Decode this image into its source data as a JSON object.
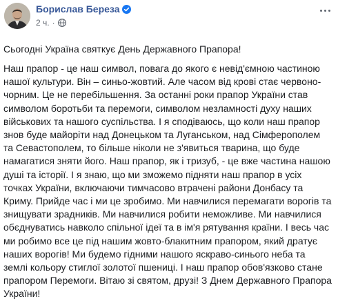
{
  "author": {
    "name": "Борислав Береза"
  },
  "meta": {
    "time": "2 ч."
  },
  "icons": {
    "verified": "verified-badge-icon",
    "privacy": "globe-icon",
    "menu": "more-options-icon",
    "verified_color": "#1877f2",
    "link_color": "#385898"
  },
  "post": {
    "intro": "Сьогодні Україна святкує День Державного Прапора!",
    "lines": [
      "Наш прапор - це наш символ, повага до якого є невід'ємною частиною",
      "нашої культури. Він – синьо-жовтий. Але часом від крові стає червоно-",
      "чорним. Це не перебільшення. За останні роки прапор України став",
      "символом боротьби та перемоги, символом незламності духу наших",
      "військових та нашого суспільства. І я сподіваюсь, що коли наш прапор",
      "знов буде майоріти над Донецьком та Луганськом, над Сімферополем",
      "та Севастополем, то більше ніколи не з'явиться тварина, що буде",
      "намагатися зняти його. Наш прапор, як і тризуб, - це вже частина нашою",
      "душі та історії. І я знаю, що ми зможемо підняти наш прапор в усіх",
      "точках України, включаючи тимчасово втрачені райони Донбасу та",
      "Криму. Прийде час і ми це зробимо. Ми навчилися перемагати ворогів та",
      "знищувати зрадників. Ми навчилися робити неможливе. Ми навчилися",
      "обєднуватись навколо спільної ідеї та в ім'я рятування країни. І весь час",
      "ми робимо все це під нашим жовто-блакитним прапором, який дратує",
      "наших ворогів! Ми будемо гідними нашого яскраво-синього неба та",
      "землі кольору стиглої золотої пшениці. І наш прапор обов'язково стане",
      "прапором Перемоги. Вітаю зі святом, друзі! З Днем Державного Прапора",
      "України!"
    ]
  }
}
